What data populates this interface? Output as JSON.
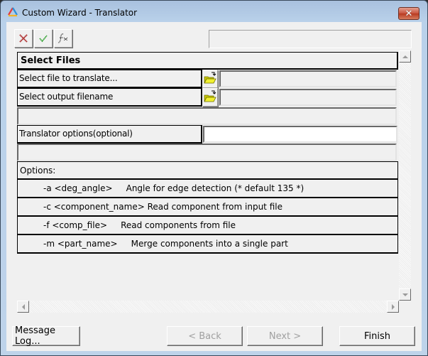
{
  "window": {
    "title": "Custom Wizard - Translator",
    "close_glyph": "✕"
  },
  "toolbar": {
    "cancel_icon": "close-x-icon",
    "apply_icon": "checkmark-icon",
    "function_icon": "fx-icon",
    "fx_text": "f(x)",
    "status_text": ""
  },
  "section": {
    "title": "Select Files"
  },
  "fields": {
    "input_file": {
      "label": "Select file to translate...",
      "value": ""
    },
    "output_file": {
      "label": "Select output filename",
      "value": ""
    },
    "translator_options": {
      "label": "Translator options(optional)",
      "value": ""
    }
  },
  "options": {
    "header": "Options:",
    "items": [
      {
        "flag": "-a <deg_angle>",
        "spacer": "     ",
        "description": "Angle for edge detection (* default 135 *)"
      },
      {
        "flag": "-c <component_name>",
        "spacer": " ",
        "description": "Read component from input file"
      },
      {
        "flag": "-f <comp_file>",
        "spacer": "     ",
        "description": "Read components from file"
      },
      {
        "flag": "-m <part_name>",
        "spacer": "     ",
        "description": "Merge components into a single part"
      }
    ]
  },
  "buttons": {
    "message_log": "Message Log...",
    "back": "< Back",
    "next": "Next >",
    "finish": "Finish"
  },
  "colors": {
    "cancel_red": "#b01f1f",
    "apply_green": "#1f9a1f",
    "folder_yellow": "#e8e800",
    "disabled_text": "#a0a0a0"
  }
}
